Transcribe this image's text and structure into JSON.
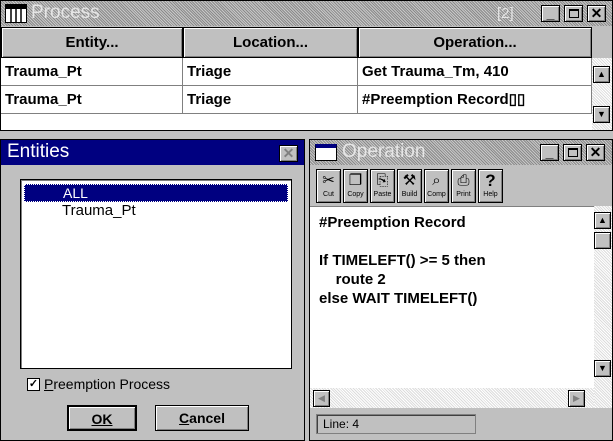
{
  "process_window": {
    "title": "Process",
    "badge": "[2]",
    "columns": [
      "Entity...",
      "Location...",
      "Operation..."
    ],
    "rows": [
      [
        "Trauma_Pt",
        "Triage",
        "Get Trauma_Tm, 410"
      ],
      [
        "Trauma_Pt",
        "Triage",
        "#Preemption Record▯▯"
      ]
    ]
  },
  "entities_dialog": {
    "title": "Entities",
    "list_items": [
      "ALL",
      "Trauma_Pt"
    ],
    "selected_index": 0,
    "checkbox": {
      "label_prefix": "",
      "label_underline": "P",
      "label_rest": "reemption Process",
      "checked": true
    },
    "ok_label": "OK",
    "cancel_label": "Cancel",
    "cancel_underline": "C",
    "cancel_rest": "ancel"
  },
  "operation_window": {
    "title": "Operation",
    "toolbar": [
      {
        "label": "Cut",
        "icon": "scissors-icon",
        "glyph": "✂"
      },
      {
        "label": "Copy",
        "icon": "copy-icon",
        "glyph": "❐"
      },
      {
        "label": "Paste",
        "icon": "paste-icon",
        "glyph": "⎘"
      },
      {
        "label": "Build",
        "icon": "hammer-icon",
        "glyph": "⚒"
      },
      {
        "label": "Comp",
        "icon": "magnifier-icon",
        "glyph": "⌕"
      },
      {
        "label": "Print",
        "icon": "printer-icon",
        "glyph": "⎙"
      },
      {
        "label": "Help",
        "icon": "help-icon",
        "glyph": "?"
      }
    ],
    "code_lines": [
      "#Preemption Record",
      "",
      "If TIMELEFT() >= 5 then",
      "    route 2",
      "else WAIT TIMELEFT()"
    ],
    "status": "Line: 4"
  }
}
